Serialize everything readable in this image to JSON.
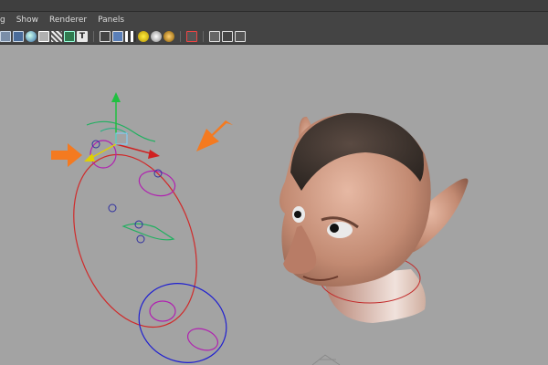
{
  "menubar": {
    "items": [
      "g",
      "Show",
      "Renderer",
      "Panels"
    ]
  },
  "toolbar": {
    "icons": [
      "grid-icon",
      "wireframe-icon",
      "smooth-shade-icon",
      "textured-icon",
      "isolate-icon",
      "camera-icon",
      "text-icon",
      "cube-wire-icon",
      "cube-blue-icon",
      "checker-cube-icon",
      "light-yellow-icon",
      "light-sphere-icon",
      "light-gold-icon",
      "film-gate-icon",
      "resolution-gate-icon",
      "safe-action-icon",
      "xray-icon",
      "hierarchy-icon"
    ]
  },
  "colors": {
    "viewport_bg": "#a3a3a3",
    "menubar_bg": "#444444",
    "arrow": "#f47a20",
    "curve_red": "#d02a2a",
    "curve_blue": "#2020d0",
    "curve_magenta": "#b020b0",
    "curve_green": "#20b060",
    "skin": "#c8917a"
  }
}
